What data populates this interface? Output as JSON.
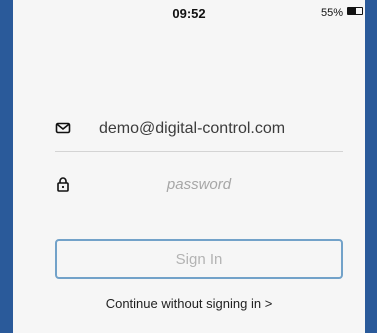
{
  "status_bar": {
    "time": "09:52",
    "battery_percent_label": "55%",
    "battery_level": 0.55
  },
  "login": {
    "email_icon": "envelope-icon",
    "email_value": "demo@digital-control.com",
    "password_icon": "lock-icon",
    "password_placeholder": "password",
    "sign_in_label": "Sign In",
    "continue_link": "Continue without signing in >"
  },
  "colors": {
    "frame": "#2a5a9a",
    "background": "#f6f6f6",
    "button_border": "#72a2c9",
    "button_text": "#b3b3b3",
    "placeholder": "#a7a7a7"
  }
}
